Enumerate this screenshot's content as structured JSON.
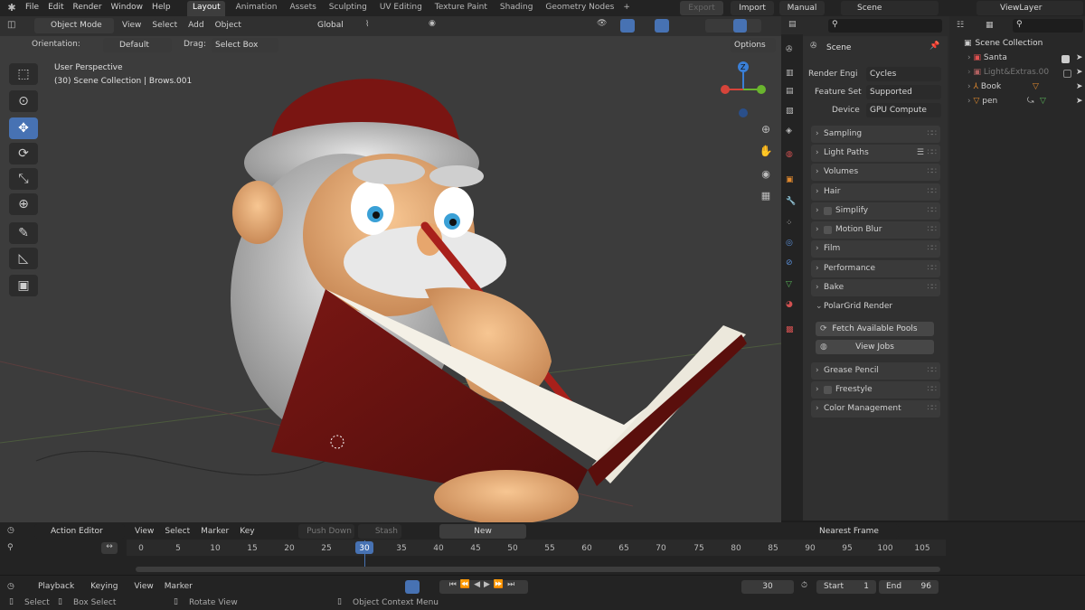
{
  "topmenu": {
    "items": [
      "File",
      "Edit",
      "Render",
      "Window",
      "Help"
    ]
  },
  "workspaces": {
    "tabs": [
      "Layout",
      "Animation",
      "Assets",
      "Sculpting",
      "UV Editing",
      "Texture Paint",
      "Shading",
      "Geometry Nodes"
    ],
    "add": "+"
  },
  "topright": {
    "export": "Export",
    "import": "Import",
    "manual": "Manual",
    "scene": "Scene",
    "viewlayer": "ViewLayer"
  },
  "viewport_header": {
    "mode": "Object Mode",
    "view": "View",
    "select": "Select",
    "add": "Add",
    "object": "Object",
    "transform": "Global"
  },
  "viewport_header2": {
    "orientation_label": "Orientation:",
    "orientation": "Default",
    "drag_label": "Drag:",
    "drag": "Select Box",
    "options": "Options"
  },
  "overlay": {
    "perspective": "User Perspective",
    "collection": "(30) Scene Collection | Brows.001"
  },
  "gizmo": {
    "z": "Z"
  },
  "properties": {
    "title": "Scene",
    "render_engine_label": "Render Engi",
    "render_engine": "Cycles",
    "feature_set_label": "Feature Set",
    "feature_set": "Supported",
    "device_label": "Device",
    "device": "GPU Compute",
    "panels": [
      "Sampling",
      "Light Paths",
      "Volumes",
      "Hair",
      "Simplify",
      "Motion Blur",
      "Film",
      "Performance",
      "Bake",
      "PolarGrid Render",
      "Grease Pencil",
      "Freestyle",
      "Color Management"
    ],
    "fetch": "Fetch Available Pools",
    "viewjobs": "View Jobs"
  },
  "outliner": {
    "root": "Scene Collection",
    "items": [
      "Santa",
      "Light&Extras.00",
      "Book",
      "pen"
    ]
  },
  "action_editor": {
    "mode": "Action Editor",
    "view": "View",
    "select": "Select",
    "marker": "Marker",
    "key": "Key",
    "push_down": "Push Down",
    "stash": "Stash",
    "new": "New",
    "snap": "Nearest Frame"
  },
  "timeline": {
    "ticks": [
      "0",
      "5",
      "10",
      "15",
      "20",
      "25",
      "30",
      "35",
      "40",
      "45",
      "50",
      "55",
      "60",
      "65",
      "70",
      "75",
      "80",
      "85",
      "90",
      "95",
      "100",
      "105"
    ],
    "current": "30",
    "playback": "Playback",
    "keying": "Keying",
    "view": "View",
    "marker": "Marker",
    "frame": "30",
    "start_label": "Start",
    "start": "1",
    "end_label": "End",
    "end": "96"
  },
  "statusbar": {
    "select": "Select",
    "box_select": "Box Select",
    "rotate": "Rotate View",
    "context": "Object Context Menu"
  },
  "colors": {
    "accent": "#4772b3",
    "active_tab": "#3d3d3d",
    "book": "#6e1512"
  }
}
